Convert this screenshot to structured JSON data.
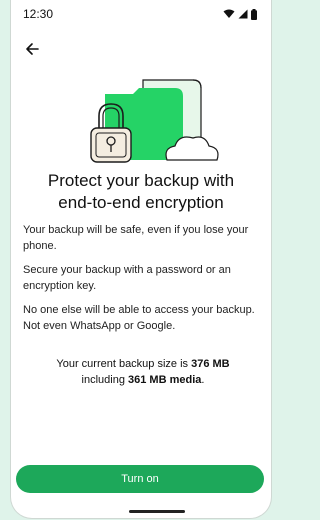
{
  "status_bar": {
    "time": "12:30"
  },
  "header": {
    "back_icon": "arrow-left-icon"
  },
  "illustration": {
    "name": "lock-folder-cloud",
    "colors": {
      "green": "#25d366",
      "light": "#e7f7ea",
      "outline": "#1c1c1c"
    }
  },
  "title": "Protect your backup with end-to-end encryption",
  "paragraphs": [
    "Your backup will be safe, even if you lose your phone.",
    "Secure your backup with a password or an encryption key.",
    "No one else will be able to access your backup. Not even WhatsApp or Google."
  ],
  "backup_info": {
    "prefix": "Your current backup size is ",
    "size": "376 MB",
    "middle": " including ",
    "media": "361 MB media",
    "suffix": "."
  },
  "cta": {
    "label": "Turn on",
    "color": "#1da85a"
  }
}
